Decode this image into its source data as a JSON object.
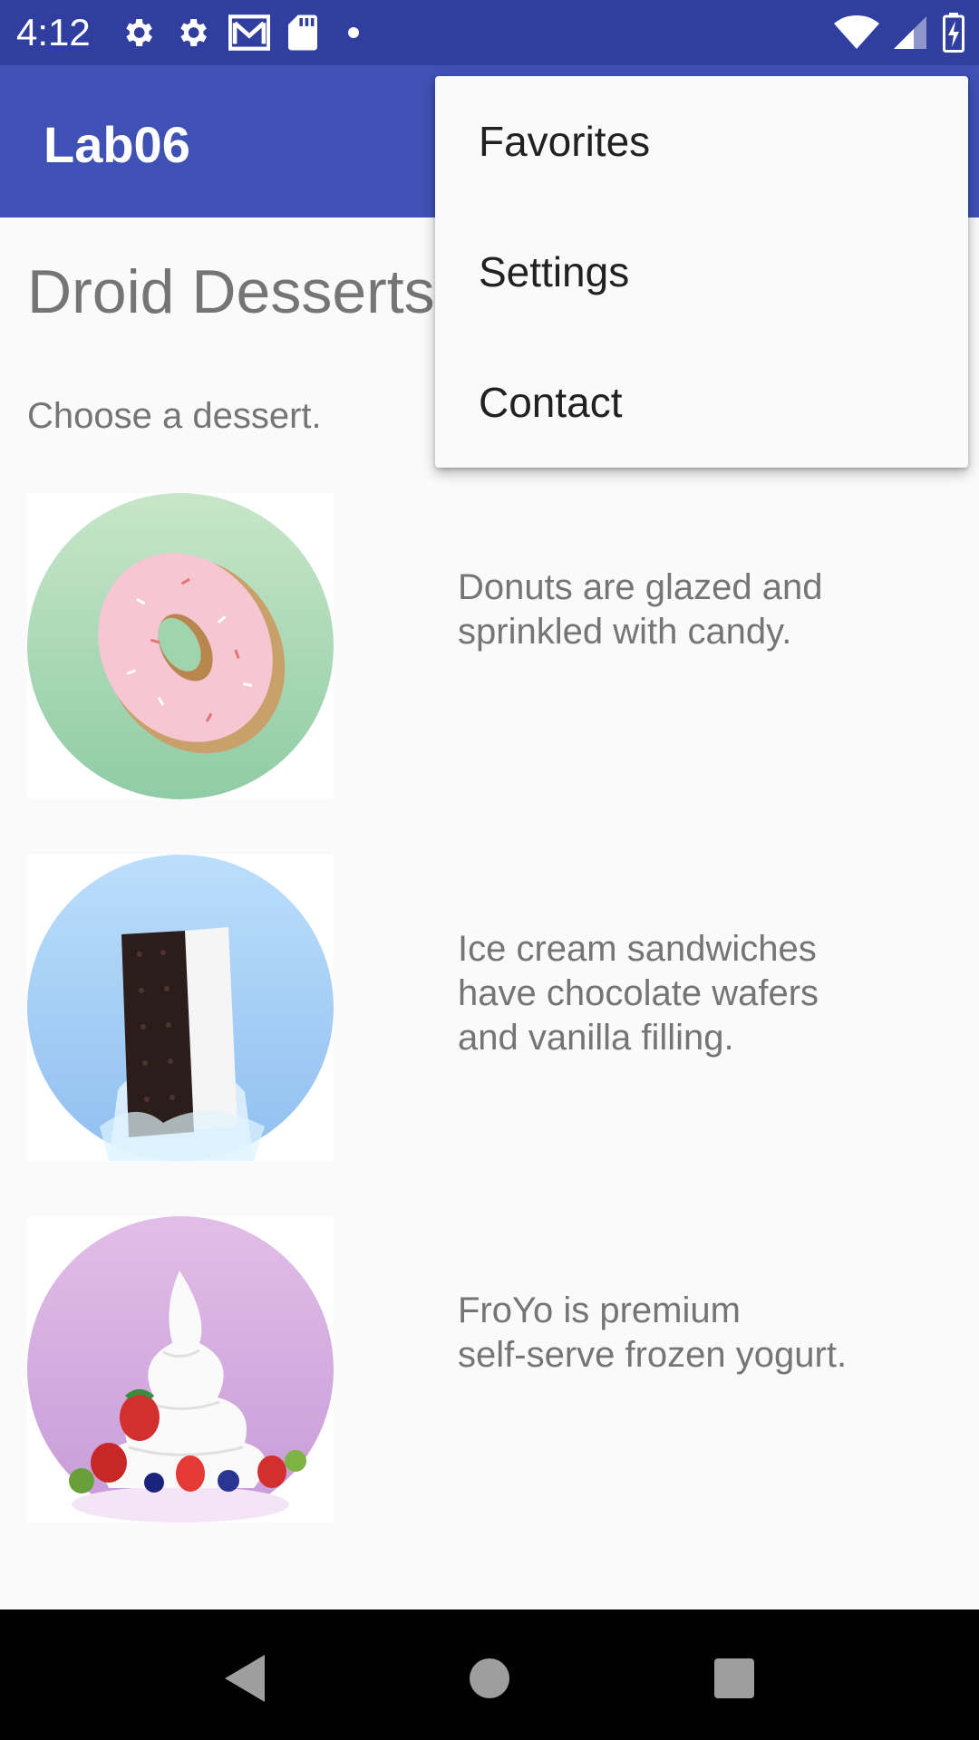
{
  "status_bar": {
    "time": "4:12",
    "left_icons": [
      "gear-icon",
      "gear-icon",
      "gmail-icon",
      "sd-card-icon",
      "dot-icon"
    ],
    "right_icons": [
      "wifi-icon",
      "cell-signal-icon",
      "battery-charging-icon"
    ],
    "background": "#303f9f"
  },
  "app_bar": {
    "title": "Lab06",
    "background": "#3f51b5"
  },
  "content": {
    "heading": "Droid Desserts",
    "subtitle": "Choose a dessert.",
    "desserts": [
      {
        "image_icon": "donut-image",
        "description": "Donuts are glazed and\nsprinkled with candy."
      },
      {
        "image_icon": "ice-cream-sandwich-image",
        "description": "Ice cream sandwiches\nhave chocolate wafers\nand vanilla filling."
      },
      {
        "image_icon": "froyo-image",
        "description": "FroYo is premium\nself-serve frozen yogurt."
      }
    ]
  },
  "overflow_menu": {
    "items": [
      {
        "label": "Favorites"
      },
      {
        "label": "Settings"
      },
      {
        "label": "Contact"
      }
    ]
  },
  "nav_bar": {
    "buttons": [
      "back-icon",
      "home-icon",
      "recents-icon"
    ]
  }
}
